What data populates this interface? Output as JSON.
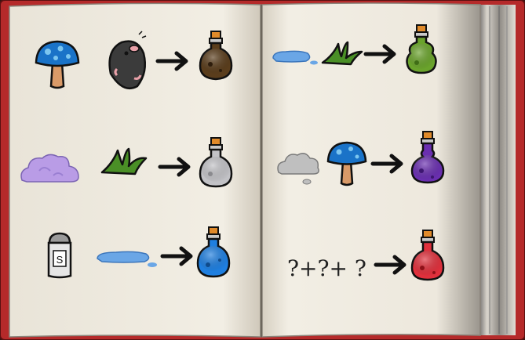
{
  "book": {
    "cover_color": "#b52a2a",
    "page_color": "#f1ede3",
    "arrow_color": "#111111"
  },
  "recipes": [
    {
      "ingredients": [
        "mushroom-icon",
        "mole-icon"
      ],
      "result": "brown-potion-icon",
      "result_color": "#5a3d1c"
    },
    {
      "ingredients": [
        "water-puddle-icon",
        "grass-icon"
      ],
      "result": "green-potion-icon",
      "result_color": "#6aa32c"
    },
    {
      "ingredients": [
        "cloud-purple-icon",
        "grass-icon"
      ],
      "result": "gray-potion-icon",
      "result_color": "#c2c2c6"
    },
    {
      "ingredients": [
        "cloud-gray-icon",
        "mushroom-icon"
      ],
      "result": "purple-potion-icon",
      "result_color": "#6a2fb0"
    },
    {
      "ingredients": [
        "salt-shaker-icon",
        "water-puddle-icon"
      ],
      "result": "blue-potion-icon",
      "result_color": "#1f7fe0"
    },
    {
      "ingredients": [],
      "result": "red-potion-icon",
      "result_color": "#e0303c"
    }
  ],
  "puzzle": {
    "question_text": "?+?+ ?",
    "salt_label": "S"
  }
}
